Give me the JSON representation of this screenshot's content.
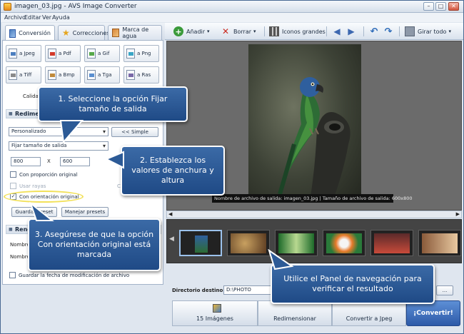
{
  "window": {
    "title": "imagen_03.jpg - AVS Image Converter",
    "controls": {
      "minimize": "–",
      "maximize": "□",
      "close": "✕"
    }
  },
  "menu": [
    "Archivo",
    "Editar",
    "Ver",
    "Ayuda"
  ],
  "left_tabs": [
    {
      "label": "Conversión",
      "icon": "convert-icon"
    },
    {
      "label": "Correcciones",
      "icon": "star-icon"
    },
    {
      "label": "Marca de agua",
      "icon": "watermark-icon"
    }
  ],
  "toolbar": {
    "add": "Añadir",
    "delete": "Borrar",
    "large_icons": "Iconos grandes",
    "rotate_all": "Girar todo"
  },
  "formats": [
    "a Jpeg",
    "a Pdf",
    "a Gif",
    "a Png",
    "a Tiff",
    "a Bmp",
    "a Tga",
    "a Ras"
  ],
  "quality_label": "Calida",
  "resize": {
    "header": "Redime",
    "preset": "Personalizado",
    "simple_button": "<< Simple",
    "mode": "Fijar tamaño de salida",
    "width": "800",
    "x_label": "X",
    "height": "600",
    "keep_proportion": "Con proporción original",
    "use_rays": "Usar rayas",
    "right_letter": "C",
    "keep_orientation": "Con orientación original",
    "save_preset": "Guardar preset",
    "manage_presets": "Manejar presets"
  },
  "rename": {
    "header": "Reno",
    "name_label": "Nombre",
    "name_label_2": "Nombre",
    "more_button": ">>"
  },
  "keep_date": "Guardar la fecha de modificación de archivo",
  "preview": {
    "caption": "Nombre de archivo de salida: imagen_03.jpg | Tamaño de archivo de salida: 600x800"
  },
  "bottom": {
    "dest_label": "Directorio destino",
    "dest_value": "D:\\PHOTO",
    "browse": "...",
    "steps": [
      "15 Imágenes",
      "Redimensionar",
      "Convertir a Jpeg"
    ],
    "convert_button": "¡Convertir!"
  },
  "callouts": {
    "c1": "1. Seleccione la opción Fijar tamaño de salida",
    "c2": "2. Establezca los valores de anchura y altura",
    "c3": "3. Asegúrese de que la opción Con orientación original está marcada",
    "c4": "Utilice el Panel de navegación para verificar el resultado"
  },
  "colors": {
    "callout": "#2c5a96",
    "accent": "#2d5aa8",
    "ring": "#f2e15a"
  }
}
